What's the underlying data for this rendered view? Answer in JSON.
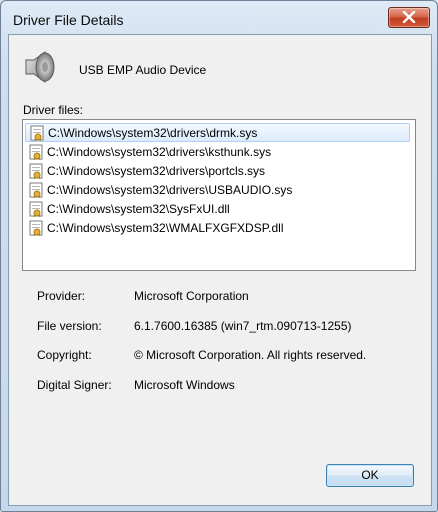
{
  "window": {
    "title": "Driver File Details"
  },
  "device": {
    "name": "USB EMP Audio Device"
  },
  "files": {
    "label": "Driver files:",
    "items": [
      "C:\\Windows\\system32\\drivers\\drmk.sys",
      "C:\\Windows\\system32\\drivers\\ksthunk.sys",
      "C:\\Windows\\system32\\drivers\\portcls.sys",
      "C:\\Windows\\system32\\drivers\\USBAUDIO.sys",
      "C:\\Windows\\system32\\SysFxUI.dll",
      "C:\\Windows\\system32\\WMALFXGFXDSP.dll"
    ],
    "selected_index": 0
  },
  "properties": {
    "provider_label": "Provider:",
    "provider_value": "Microsoft Corporation",
    "version_label": "File version:",
    "version_value": "6.1.7600.16385 (win7_rtm.090713-1255)",
    "copyright_label": "Copyright:",
    "copyright_value": "© Microsoft Corporation. All rights reserved.",
    "signer_label": "Digital Signer:",
    "signer_value": "Microsoft Windows"
  },
  "buttons": {
    "ok": "OK"
  },
  "icons": {
    "close": "close-icon",
    "device": "speaker-icon",
    "file": "signed-file-icon"
  },
  "colors": {
    "close_button": "#c13e20",
    "selection_border": "#b0cff3",
    "ok_border": "#3c7fb1"
  }
}
